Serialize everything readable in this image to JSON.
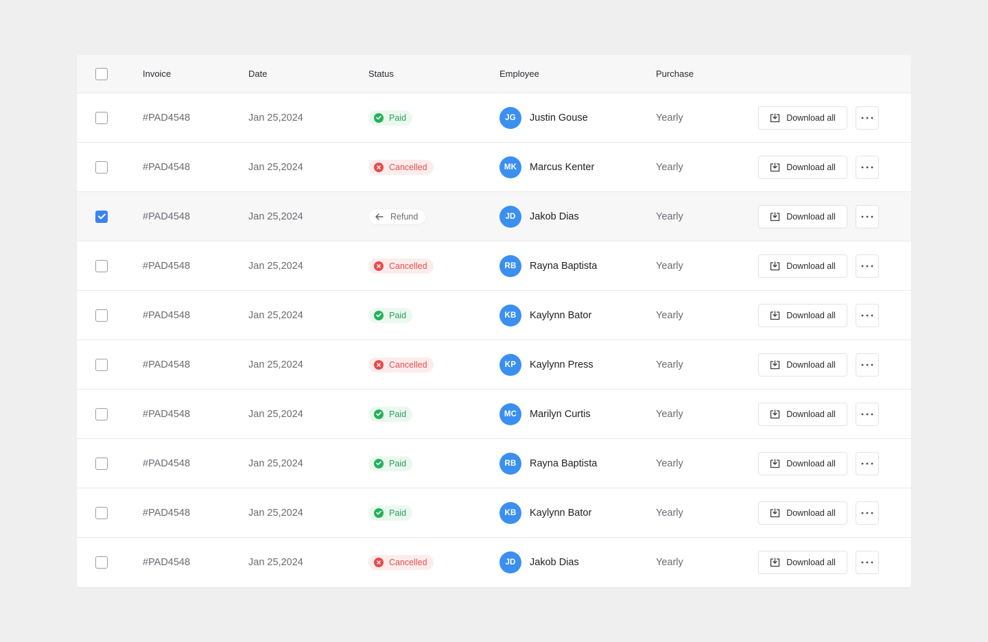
{
  "table": {
    "headers": {
      "invoice": "Invoice",
      "date": "Date",
      "status": "Status",
      "employee": "Employee",
      "purchase": "Purchase"
    },
    "colors": {
      "accent": "#3b82f6",
      "paid_text": "#29a15a",
      "paid_bg": "#ebf8ef",
      "cancelled_text": "#e3504f",
      "cancelled_bg": "#fdecec",
      "avatar_bg": "#3b8ff0",
      "page_bg": "#efefef"
    },
    "actions": {
      "download_label": "Download all",
      "download_icon": "download-tray-icon",
      "more_icon": "ellipsis-icon"
    },
    "rows": [
      {
        "checked": false,
        "invoice": "#PAD4548",
        "date": "Jan 25,2024",
        "status": "Paid",
        "status_kind": "paid",
        "initials": "JG",
        "name": "Justin Gouse",
        "purchase": "Yearly"
      },
      {
        "checked": false,
        "invoice": "#PAD4548",
        "date": "Jan 25,2024",
        "status": "Cancelled",
        "status_kind": "cancelled",
        "initials": "MK",
        "name": "Marcus Kenter",
        "purchase": "Yearly"
      },
      {
        "checked": true,
        "invoice": "#PAD4548",
        "date": "Jan 25,2024",
        "status": "Refund",
        "status_kind": "refund",
        "initials": "JD",
        "name": "Jakob Dias",
        "purchase": "Yearly"
      },
      {
        "checked": false,
        "invoice": "#PAD4548",
        "date": "Jan 25,2024",
        "status": "Cancelled",
        "status_kind": "cancelled",
        "initials": "RB",
        "name": "Rayna Baptista",
        "purchase": "Yearly"
      },
      {
        "checked": false,
        "invoice": "#PAD4548",
        "date": "Jan 25,2024",
        "status": "Paid",
        "status_kind": "paid",
        "initials": "KB",
        "name": "Kaylynn Bator",
        "purchase": "Yearly"
      },
      {
        "checked": false,
        "invoice": "#PAD4548",
        "date": "Jan 25,2024",
        "status": "Cancelled",
        "status_kind": "cancelled",
        "initials": "KP",
        "name": "Kaylynn Press",
        "purchase": "Yearly"
      },
      {
        "checked": false,
        "invoice": "#PAD4548",
        "date": "Jan 25,2024",
        "status": "Paid",
        "status_kind": "paid",
        "initials": "MC",
        "name": "Marilyn Curtis",
        "purchase": "Yearly"
      },
      {
        "checked": false,
        "invoice": "#PAD4548",
        "date": "Jan 25,2024",
        "status": "Paid",
        "status_kind": "paid",
        "initials": "RB",
        "name": "Rayna Baptista",
        "purchase": "Yearly"
      },
      {
        "checked": false,
        "invoice": "#PAD4548",
        "date": "Jan 25,2024",
        "status": "Paid",
        "status_kind": "paid",
        "initials": "KB",
        "name": "Kaylynn Bator",
        "purchase": "Yearly"
      },
      {
        "checked": false,
        "invoice": "#PAD4548",
        "date": "Jan 25,2024",
        "status": "Cancelled",
        "status_kind": "cancelled",
        "initials": "JD",
        "name": "Jakob Dias",
        "purchase": "Yearly"
      }
    ]
  }
}
